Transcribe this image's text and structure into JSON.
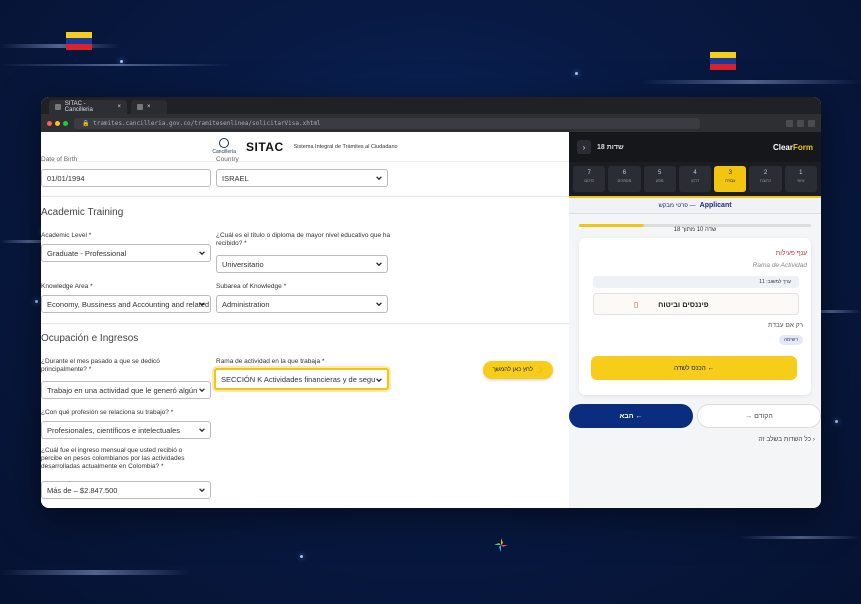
{
  "browser": {
    "tabs": [
      {
        "label": "SITAC - Cancilleria"
      },
      {
        "label": ""
      }
    ],
    "url": "tramites.cancilleria.gov.co/tramitesenlinea/solicitarVisa.xhtml",
    "lights": [
      "#ff5f57",
      "#febc2e",
      "#28c840"
    ]
  },
  "sitac": {
    "cancilleria": "Cancillería",
    "logo": "SITAC",
    "subtitle": "Sistema Integral de Trámites al Ciudadano"
  },
  "form": {
    "top_row": {
      "birth_label": "Date of Birth",
      "birth_value": "01/01/1994",
      "country_label": "Country",
      "country_value": "ISRAEL"
    },
    "academic_title": "Academic Training",
    "academic_level_label": "Academic Level *",
    "academic_level_value": "Graduate - Professional",
    "degree_label": "¿Cuál es el título o diploma de mayor nivel educativo que ha recibido? *",
    "degree_value": "Universitario",
    "knowledge_area_label": "Knowledge Area *",
    "knowledge_area_value": "Economy, Bussiness and Accounting and related",
    "subarea_label": "Subarea of Knowledge *",
    "subarea_value": "Administration",
    "income_title": "Ocupación e Ingresos",
    "activity_label": "¿Durante el mes pasado a que se dedicó principalmente? *",
    "activity_value": "Trabajo en una actividad que le generó algún",
    "branch_label": "Rama de actividad en la que trabaja *",
    "branch_value": "SECCIÓN K Actividades financieras y de segu",
    "profession_label": "¿Con qué profesión se relaciona su trabajo? *",
    "profession_value": "Profesionales, científicos e intelectuales",
    "income_label": "¿Cuál fue el ingreso mensual que usted recibió o percibe en pesos colombianos por las actividades desarrolladas actualmente en Colombia? *",
    "income_value": "Más de – $2.847.500",
    "click_button": "לחץ כאן להמשך"
  },
  "clearform": {
    "header_title": "18 שדות",
    "logo_prefix": "Clear",
    "logo_suffix": "Form",
    "steps": [
      {
        "num": "7",
        "label": "סיכום"
      },
      {
        "num": "6",
        "label": "מסמכים"
      },
      {
        "num": "5",
        "label": "מסע"
      },
      {
        "num": "4",
        "label": "דרכון"
      },
      {
        "num": "3",
        "label": "עבודה"
      },
      {
        "num": "2",
        "label": "כתובת"
      },
      {
        "num": "1",
        "label": "אישי"
      }
    ],
    "current_step": 3,
    "applicant_label": "Applicant",
    "applicant_note": "פרטי מבקש —",
    "progress_text": "שדה 10 מתוך 18",
    "progress_fraction": 0.28,
    "field_he": "ענף פעילות",
    "field_es": "Rama de Actividad",
    "hint": "ערך למשוב: 11",
    "field_value": "פיננסים וביטוח",
    "only_if": "רק אם עבדת",
    "badge": "רשימה",
    "go_button": "הכנס לשדה ←",
    "next_button": "הבא ←",
    "prev_button": "→ הקודם",
    "all_fields": "כל השדות בשלב זה ›"
  }
}
